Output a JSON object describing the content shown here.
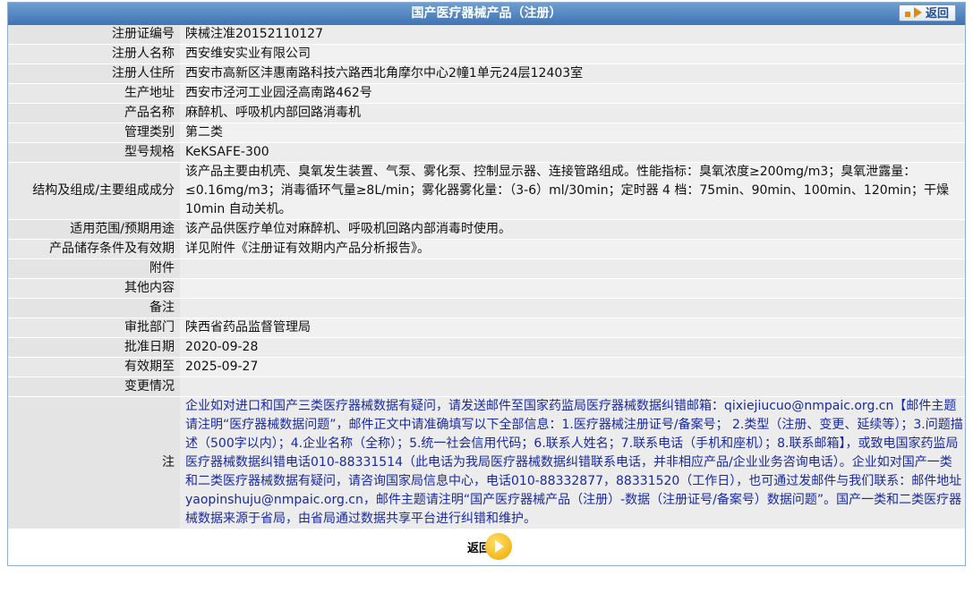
{
  "header": {
    "title": "国产医疗器械产品（注册）",
    "back_label": "返回"
  },
  "rows": [
    {
      "label": "注册证编号",
      "value": "陕械注准20152110127"
    },
    {
      "label": "注册人名称",
      "value": "西安维安实业有限公司"
    },
    {
      "label": "注册人住所",
      "value": "西安市高新区沣惠南路科技六路西北角摩尔中心2幢1单元24层12403室"
    },
    {
      "label": "生产地址",
      "value": "西安市泾河工业园泾高南路462号"
    },
    {
      "label": "产品名称",
      "value": "麻醉机、呼吸机内部回路消毒机"
    },
    {
      "label": "管理类别",
      "value": "第二类"
    },
    {
      "label": "型号规格",
      "value": "KeKSAFE-300"
    },
    {
      "label": "结构及组成/主要组成成分",
      "value": "该产品主要由机壳、臭氧发生装置、气泵、雾化泵、控制显示器、连接管路组成。性能指标：臭氧浓度≥200mg/m3；臭氧泄露量：≤0.16mg/m3；消毒循环气量≥8L/min；雾化器雾化量：（3-6）ml/30min；定时器 4 档：75min、90min、100min、120min；干燥 10min 自动关机。"
    },
    {
      "label": "适用范围/预期用途",
      "value": "该产品供医疗单位对麻醉机、呼吸机回路内部消毒时使用。"
    },
    {
      "label": "产品储存条件及有效期",
      "value": "详见附件《注册证有效期内产品分析报告》。"
    },
    {
      "label": "附件",
      "value": ""
    },
    {
      "label": "其他内容",
      "value": ""
    },
    {
      "label": "备注",
      "value": ""
    },
    {
      "label": "审批部门",
      "value": "陕西省药品监督管理局"
    },
    {
      "label": "批准日期",
      "value": "2020-09-28"
    },
    {
      "label": "有效期至",
      "value": "2025-09-27"
    },
    {
      "label": "变更情况",
      "value": ""
    }
  ],
  "note": {
    "label": "注",
    "text": "企业如对进口和国产三类医疗器械数据有疑问，请发送邮件至国家药监局医疗器械数据纠错邮箱：qixiejiucuo@nmpaic.org.cn【邮件主题请注明“医疗器械数据问题”，邮件正文中请准确填写以下全部信息：1.医疗器械注册证号/备案号； 2.类型（注册、变更、延续等）；3.问题描述（500字以内）；4.企业名称（全称）；5.统一社会信用代码；6.联系人姓名；7.联系电话（手机和座机）；8.联系邮箱】，或致电国家药监局医疗器械数据纠错电话010-88331514（此电话为我局医疗器械数据纠错联系电话，并非相应产品/企业业务咨询电话）。企业如对国产一类和二类医疗器械数据有疑问，请咨询国家局信息中心，电话010-88332877，88331520（工作日），也可通过发邮件与我们联系：邮件地址yaopinshuju@nmpaic.org.cn，邮件主题请注明“国产医疗器械产品（注册）-数据（注册证号/备案号）数据问题”。国产一类和二类医疗器械数据来源于省局，由省局通过数据共享平台进行纠错和维护。"
  },
  "footer": {
    "back_label": "返回"
  }
}
